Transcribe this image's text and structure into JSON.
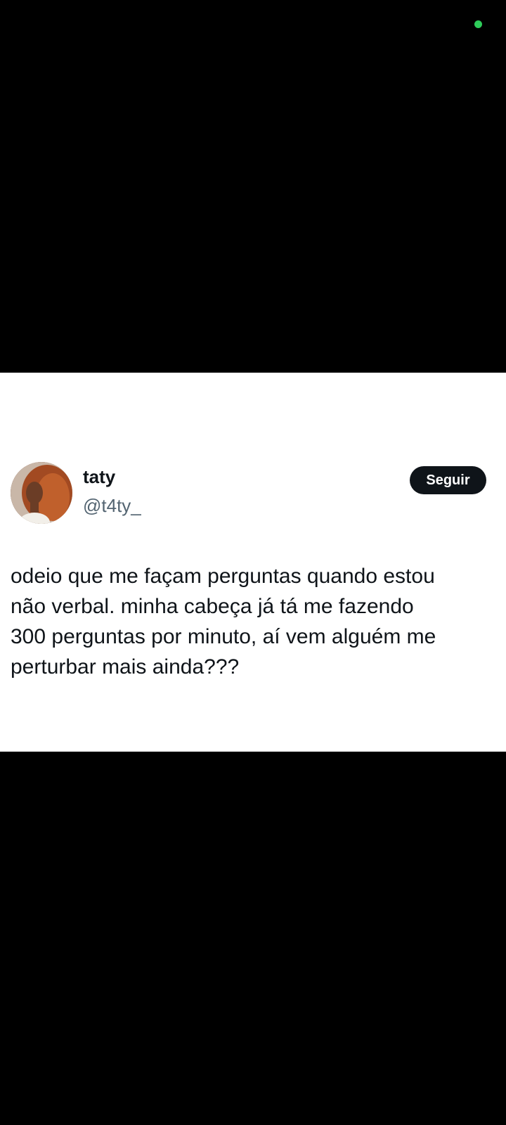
{
  "status": {
    "indicator_color": "#2ecc5a"
  },
  "tweet": {
    "author": {
      "name": "taty",
      "handle": "@t4ty_",
      "avatar_icon": "profile-photo"
    },
    "follow_label": "Seguir",
    "text_lines": [
      "odeio que me façam perguntas quando estou",
      "não verbal. minha cabeça já tá me fazendo",
      "300 perguntas por minuto, aí vem alguém me",
      "perturbar mais ainda???"
    ]
  },
  "colors": {
    "background": "#000000",
    "card": "#ffffff",
    "text": "#0f1419",
    "muted": "#536471",
    "button": "#0f1419"
  }
}
